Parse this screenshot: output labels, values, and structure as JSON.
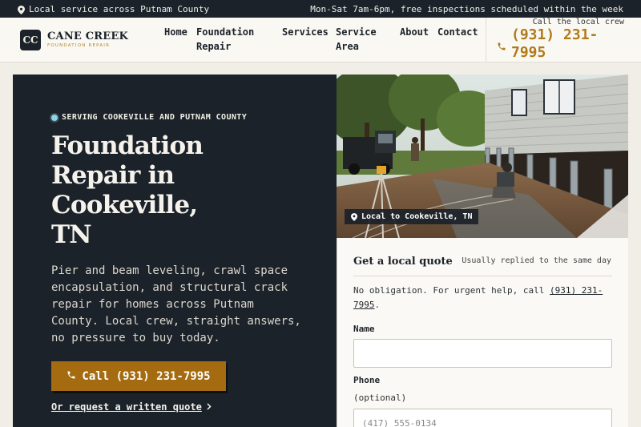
{
  "topbar": {
    "location": "Local service across Putnam County",
    "hours": "Mon-Sat 7am-6pm, free inspections scheduled within the week"
  },
  "brand": {
    "initials": "CC",
    "name": "CANE CREEK",
    "tagline": "FOUNDATION REPAIR"
  },
  "nav": {
    "home": "Home",
    "foundation_line1": "Foundation",
    "foundation_line2": "Repair",
    "services": "Services",
    "service_area_line1": "Service",
    "service_area_line2": "Area",
    "about": "About",
    "contact": "Contact"
  },
  "header_call": {
    "caption": "Call the local crew",
    "phone": "(931) 231-7995"
  },
  "hero": {
    "badge": "SERVING COOKEVILLE AND PUTNAM COUNTY",
    "title": "Foundation Repair in Cookeville, TN",
    "description": "Pier and beam leveling, crawl space encapsulation, and structural crack repair for homes across Putnam County. Local crew, straight answers, no pressure to buy today.",
    "cta": "Call (931) 231-7995",
    "secondary": "Or request a written quote"
  },
  "photo": {
    "tag": "Local to Cookeville, TN"
  },
  "quote": {
    "title": "Get a local quote",
    "meta": "Usually replied to the same day",
    "note_prefix": "No obligation. For urgent help, call ",
    "note_phone": "(931) 231-7995",
    "note_suffix": ".",
    "name_label": "Name",
    "name_value": "",
    "phone_label": "Phone",
    "phone_optional": "(optional)",
    "phone_placeholder": "(417) 555-0134"
  },
  "colors": {
    "dark": "#1b2229",
    "accent": "#a56b10",
    "accent_text": "#b07a18",
    "cream": "#faf8f3"
  }
}
